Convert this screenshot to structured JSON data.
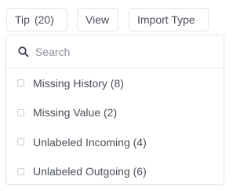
{
  "toolbar": {
    "tip_label": "Tip",
    "tip_count": "(20)",
    "view_label": "View",
    "import_type_label": "Import Type"
  },
  "dropdown": {
    "search": {
      "placeholder": "Search",
      "value": ""
    },
    "options": [
      {
        "label": "Missing History (8)",
        "checked": false
      },
      {
        "label": "Missing Value (2)",
        "checked": false
      },
      {
        "label": "Unlabeled Incoming (4)",
        "checked": false
      },
      {
        "label": "Unlabeled Outgoing (6)",
        "checked": false
      }
    ]
  },
  "icons": {
    "search": "search-icon"
  }
}
